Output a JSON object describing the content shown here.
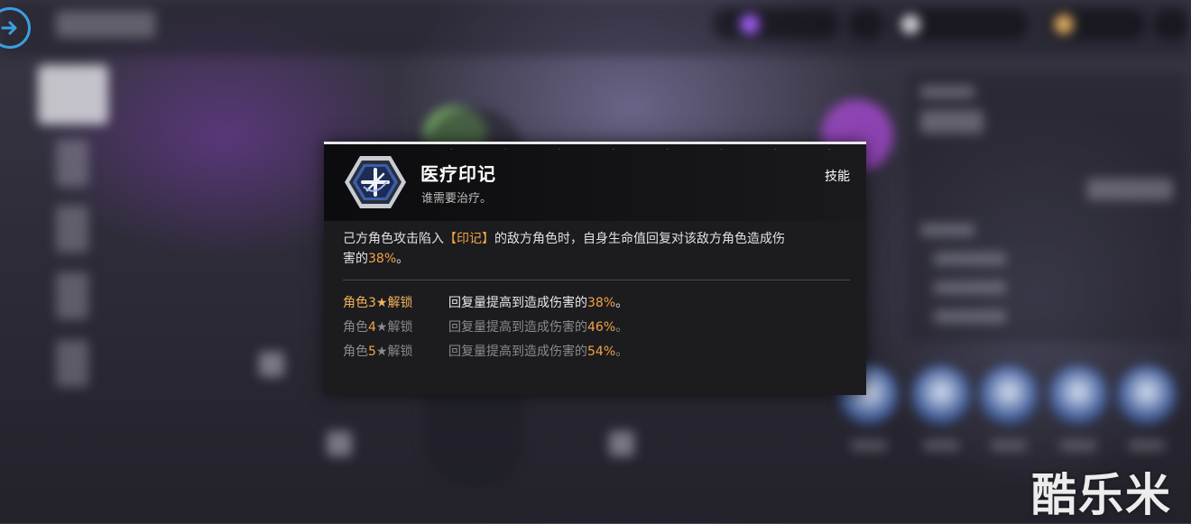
{
  "popup": {
    "title": "医疗印记",
    "subtitle": "谁需要治疗。",
    "type_label": "技能",
    "icon": "medical-mark-icon",
    "description": {
      "part1": "己方角色攻击陷入",
      "keyword": "【印记】",
      "part2": "的敌方角色时，自身生命值回复对该敌方角色造成伤",
      "part3": "害的",
      "value": "38%",
      "end": "。"
    },
    "unlocks": [
      {
        "prefix": "角色",
        "stars": "3",
        "star": "★",
        "suffix": "解锁",
        "effect": "回复量提高到造成伤害的",
        "value": "38%",
        "end": "。",
        "active": true
      },
      {
        "prefix": "角色",
        "stars": "4",
        "star": "★",
        "suffix": "解锁",
        "effect": "回复量提高到造成伤害的",
        "value": "46%",
        "end": "。",
        "active": false
      },
      {
        "prefix": "角色",
        "stars": "5",
        "star": "★",
        "suffix": "解锁",
        "effect": "回复量提高到造成伤害的",
        "value": "54%",
        "end": "。",
        "active": false
      }
    ]
  },
  "watermark": "酷乐米",
  "colors": {
    "highlight": "#f2a444",
    "active_unlock": "#f2b35a",
    "inactive_unlock": "#8a8a8e",
    "back_button": "#3aa0e0"
  },
  "icons": {
    "back": "arrow-right-circle-icon"
  }
}
